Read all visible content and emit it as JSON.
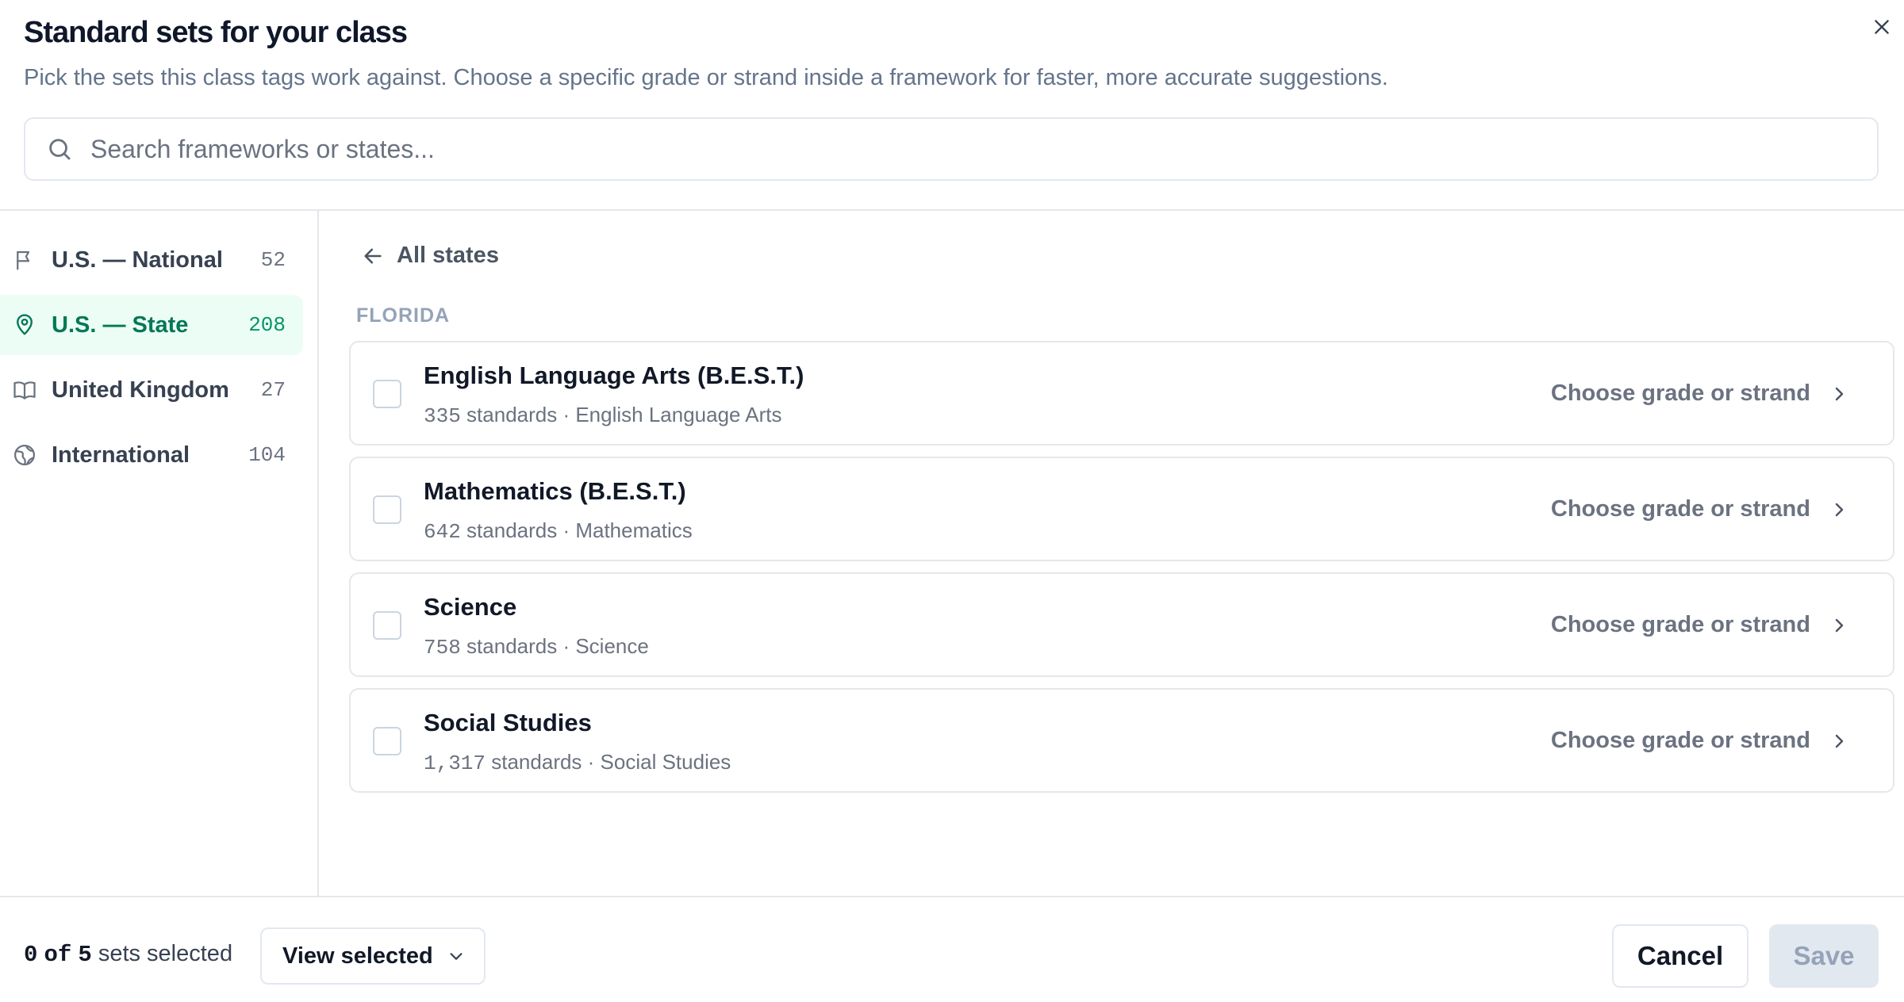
{
  "header": {
    "title": "Standard sets for your class",
    "subtitle": "Pick the sets this class tags work against. Choose a specific grade or strand inside a framework for faster, more accurate suggestions.",
    "search_placeholder": "Search frameworks or states..."
  },
  "sidebar": {
    "items": [
      {
        "label": "U.S. — National",
        "count": "52",
        "icon": "flag-icon",
        "active": false
      },
      {
        "label": "U.S. — State",
        "count": "208",
        "icon": "map-pin-icon",
        "active": true
      },
      {
        "label": "United Kingdom",
        "count": "27",
        "icon": "book-open-icon",
        "active": false
      },
      {
        "label": "International",
        "count": "104",
        "icon": "globe-icon",
        "active": false
      }
    ]
  },
  "main": {
    "back_label": "All states",
    "state_label": "FLORIDA",
    "action_label": "Choose grade or strand",
    "sets": [
      {
        "name": "English Language Arts (B.E.S.T.)",
        "count": "335",
        "unit": "standards",
        "subject": "English Language Arts",
        "checked": false
      },
      {
        "name": "Mathematics (B.E.S.T.)",
        "count": "642",
        "unit": "standards",
        "subject": "Mathematics",
        "checked": false
      },
      {
        "name": "Science",
        "count": "758",
        "unit": "standards",
        "subject": "Science",
        "checked": false
      },
      {
        "name": "Social Studies",
        "count": "1,317",
        "unit": "standards",
        "subject": "Social Studies",
        "checked": false
      }
    ]
  },
  "footer": {
    "selected_count": "0",
    "of_label": "of",
    "total_count": "5",
    "selected_suffix": "sets selected",
    "view_selected_label": "View selected",
    "cancel_label": "Cancel",
    "save_label": "Save"
  },
  "colors": {
    "accent": "#047857",
    "accent_bg": "#ecfdf5",
    "muted_text": "#6b7280",
    "border": "#e5e7eb",
    "disabled_bg": "#e2e8f0"
  }
}
